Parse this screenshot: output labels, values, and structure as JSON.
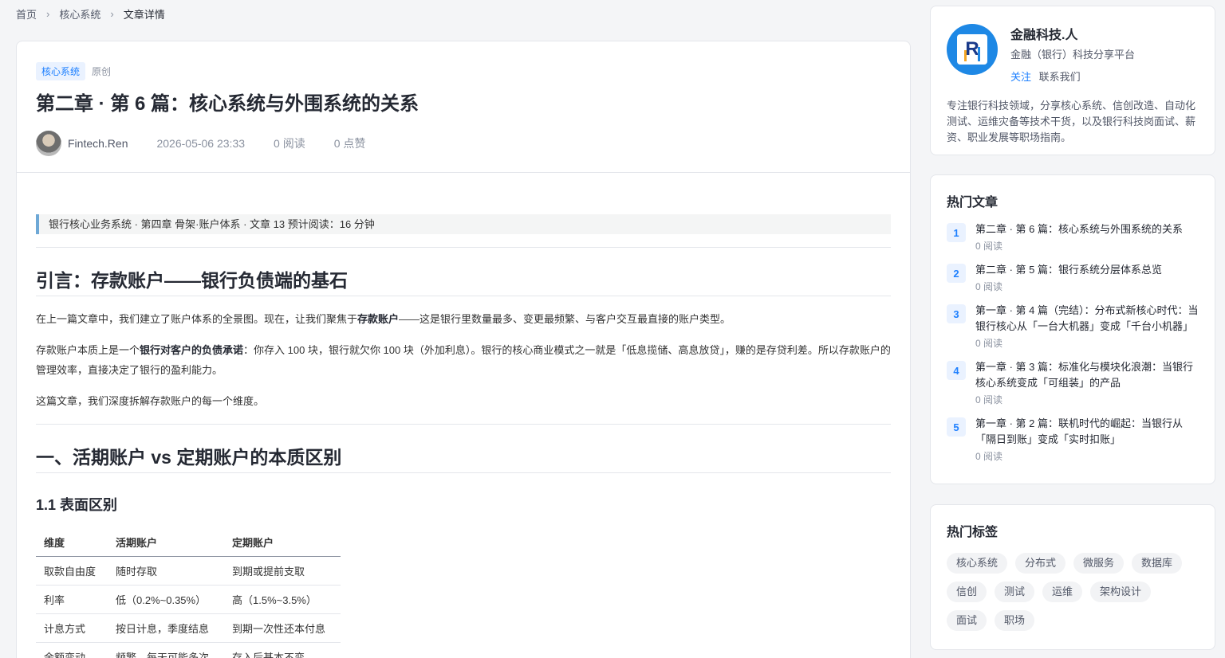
{
  "breadcrumb": {
    "home": "首页",
    "section": "核心系统",
    "current": "文章详情"
  },
  "article": {
    "category_tag": "核心系统",
    "original_tag": "原创",
    "title": "第二章 · 第 6 篇：核心系统与外围系统的关系",
    "author": "Fintech.Ren",
    "datetime": "2026-05-06 23:33",
    "reads": "0 阅读",
    "likes": "0 点赞",
    "quote": "银行核心业务系统 · 第四章 骨架·账户体系 · 文章 13 预计阅读：16 分钟",
    "h_intro": "引言：存款账户——银行负债端的基石",
    "p1_a": "在上一篇文章中，我们建立了账户体系的全景图。现在，让我们聚焦于",
    "p1_b": "存款账户",
    "p1_c": "——这是银行里数量最多、变更最频繁、与客户交互最直接的账户类型。",
    "p2_a": "存款账户本质上是一个",
    "p2_b": "银行对客户的负债承诺",
    "p2_c": "：你存入 100 块，银行就欠你 100 块（外加利息）。银行的核心商业模式之一就是「低息揽储、高息放贷」，赚的是存贷利差。所以存款账户的管理效率，直接决定了银行的盈利能力。",
    "p3": "这篇文章，我们深度拆解存款账户的每一个维度。",
    "h_section1": "一、活期账户 vs 定期账户的本质区别",
    "h_sub11": "1.1 表面区别",
    "table": {
      "headers": [
        "维度",
        "活期账户",
        "定期账户"
      ],
      "rows": [
        [
          "取款自由度",
          "随时存取",
          "到期或提前支取"
        ],
        [
          "利率",
          "低（0.2%~0.35%）",
          "高（1.5%~3.5%）"
        ],
        [
          "计息方式",
          "按日计息，季度结息",
          "到期一次性还本付息"
        ],
        [
          "余额变动",
          "频繁，每天可能多次",
          "存入后基本不变"
        ]
      ]
    }
  },
  "profile": {
    "name": "金融科技.人",
    "subtitle": "金融（银行）科技分享平台",
    "follow": "关注",
    "contact": "联系我们",
    "description": "专注银行科技领域，分享核心系统、信创改造、自动化测试、运维灾备等技术干货，以及银行科技岗面试、薪资、职业发展等职场指南。",
    "logo_letter": "R"
  },
  "hot_articles": {
    "title": "热门文章",
    "items": [
      {
        "num": "1",
        "title": "第二章 · 第 6 篇：核心系统与外围系统的关系",
        "reads": "0 阅读"
      },
      {
        "num": "2",
        "title": "第二章 · 第 5 篇：银行系统分层体系总览",
        "reads": "0 阅读"
      },
      {
        "num": "3",
        "title": "第一章 · 第 4 篇（完结）：分布式新核心时代：当银行核心从「一台大机器」变成「千台小机器」",
        "reads": "0 阅读"
      },
      {
        "num": "4",
        "title": "第一章 · 第 3 篇：标准化与模块化浪潮：当银行核心系统变成「可组装」的产品",
        "reads": "0 阅读"
      },
      {
        "num": "5",
        "title": "第一章 · 第 2 篇：联机时代的崛起：当银行从「隔日到账」变成「实时扣账」",
        "reads": "0 阅读"
      }
    ]
  },
  "hot_tags": {
    "title": "热门标签",
    "tags": [
      "核心系统",
      "分布式",
      "微服务",
      "数据库",
      "信创",
      "测试",
      "运维",
      "架构设计",
      "面试",
      "职场"
    ]
  },
  "colors": {
    "accent": "#1e80ff",
    "page_bg": "#f4f5f7",
    "quote_border": "#6ea8d6"
  }
}
